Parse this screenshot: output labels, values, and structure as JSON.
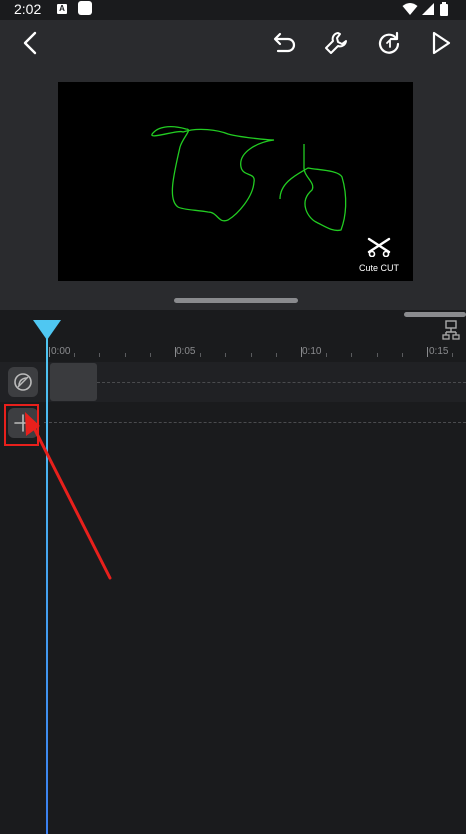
{
  "status_bar": {
    "time": "2:02",
    "notification_icon_letter": "A"
  },
  "toolbar": {
    "back_icon": "chevron-left-icon",
    "undo_icon": "undo-icon",
    "tools_icon": "wrench-icon",
    "redo_icon": "redo-icon",
    "play_icon": "play-icon"
  },
  "preview": {
    "watermark_text": "Cute CUT",
    "background": "#000000",
    "drawing_color": "#22cc22"
  },
  "timeline": {
    "ticks": [
      "0:00",
      "0:05",
      "0:10",
      "0:15"
    ],
    "playhead_color": "#4fc7f2",
    "tracks": [
      {
        "name": "main-track",
        "icon": "recycle-icon"
      },
      {
        "name": "add-track",
        "icon": "plus-icon"
      }
    ]
  },
  "annotation": {
    "highlight_color": "#e8201c"
  }
}
